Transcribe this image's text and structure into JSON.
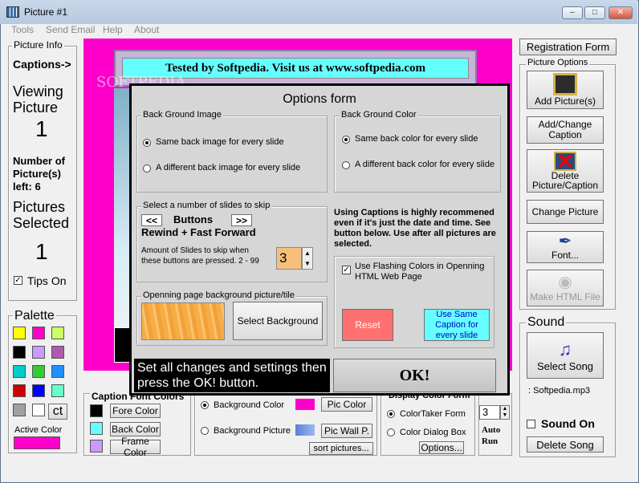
{
  "window": {
    "title": "Picture #1"
  },
  "menu": [
    "Tools",
    "Send Email",
    "Help",
    "About"
  ],
  "left": {
    "group_title": "Picture Info",
    "captions_label": "Captions->",
    "viewing_label": "Viewing Picture",
    "viewing_value": "1",
    "number_label": "Number of Picture(s) left: 6",
    "selected_label": "Pictures Selected",
    "selected_value": "1",
    "tips_label": "Tips On",
    "palette_title": "Palette",
    "palette_colors": [
      "#ffff00",
      "#ff00cc",
      "#ccff66",
      "#000000",
      "#cc99ff",
      "#b05aad",
      "#00cccc",
      "#33cc33",
      "#1e90ff",
      "#cc0000",
      "#0000ff",
      "#66ffcc",
      "#a0a0a0",
      "#ffffff"
    ],
    "ct_button": "ct",
    "active_color_label": "Active Color",
    "active_color": "#ff00cc"
  },
  "banner_text": "Tested by Softpedia. Visit us at www.softpedia.com",
  "right": {
    "registration_button": "Registration Form",
    "picture_options_title": "Picture Options",
    "add_picture": "Add Picture(s)",
    "add_change_caption": "Add/Change Caption",
    "delete_picture": "Delete Picture/Caption",
    "change_picture": "Change Picture",
    "font_button": "Font...",
    "make_html": "Make HTML File",
    "sound_title": "Sound",
    "select_song": "Select Song",
    "song_name": ": Softpedia.mp3",
    "sound_on": "Sound On",
    "delete_song": "Delete Song",
    "spinner_value": "3",
    "auto_run": "Auto Run"
  },
  "bottom": {
    "caption_title": "Caption Font Colors",
    "fore_color": "Fore Color",
    "back_color": "Back Color",
    "frame_color": "Frame Color",
    "bg_color_radio": "Background Color",
    "bg_picture_radio": "Background Picture",
    "pic_color_btn": "Pic Color",
    "pic_wall_btn": "Pic Wall P.",
    "sort_btn": "sort pictures...",
    "display_title": "Display Color Form",
    "colortaker": "ColorTaker Form",
    "color_dialog": "Color Dialog Box",
    "options_btn": "Options..."
  },
  "dialog": {
    "title": "Options form",
    "back_image_title": "Back Ground Image",
    "same_image": "Same back image for every slide",
    "diff_image": "A different back image for every slide",
    "back_color_title": "Back Ground Color",
    "same_color": "Same back color for every slide",
    "diff_color": "A different back color for every slide",
    "skip_title": "Select a number of slides to skip",
    "rewind_btn": "<<",
    "ff_btn": ">>",
    "buttons_label": "Buttons",
    "rewind_label": "Rewind  + Fast Forward",
    "skip_desc": "Amount of Slides to skip when these buttons are pressed. 2 - 99",
    "skip_value": "3",
    "captions_note": "Using Captions is highly recommened even if it's just the date and time. See button below. Use after all pictures are selected.",
    "flashing_label": "Use Flashing Colors in Openning HTML Web Page",
    "opening_title": "Openning page background picture/tile",
    "select_bg_btn": "Select Background",
    "reset_btn": "Reset",
    "same_caption_btn": "Use Same Caption for every slide",
    "footer_text": "Set all changes and settings then press the OK! button.",
    "ok_btn": "OK!"
  }
}
